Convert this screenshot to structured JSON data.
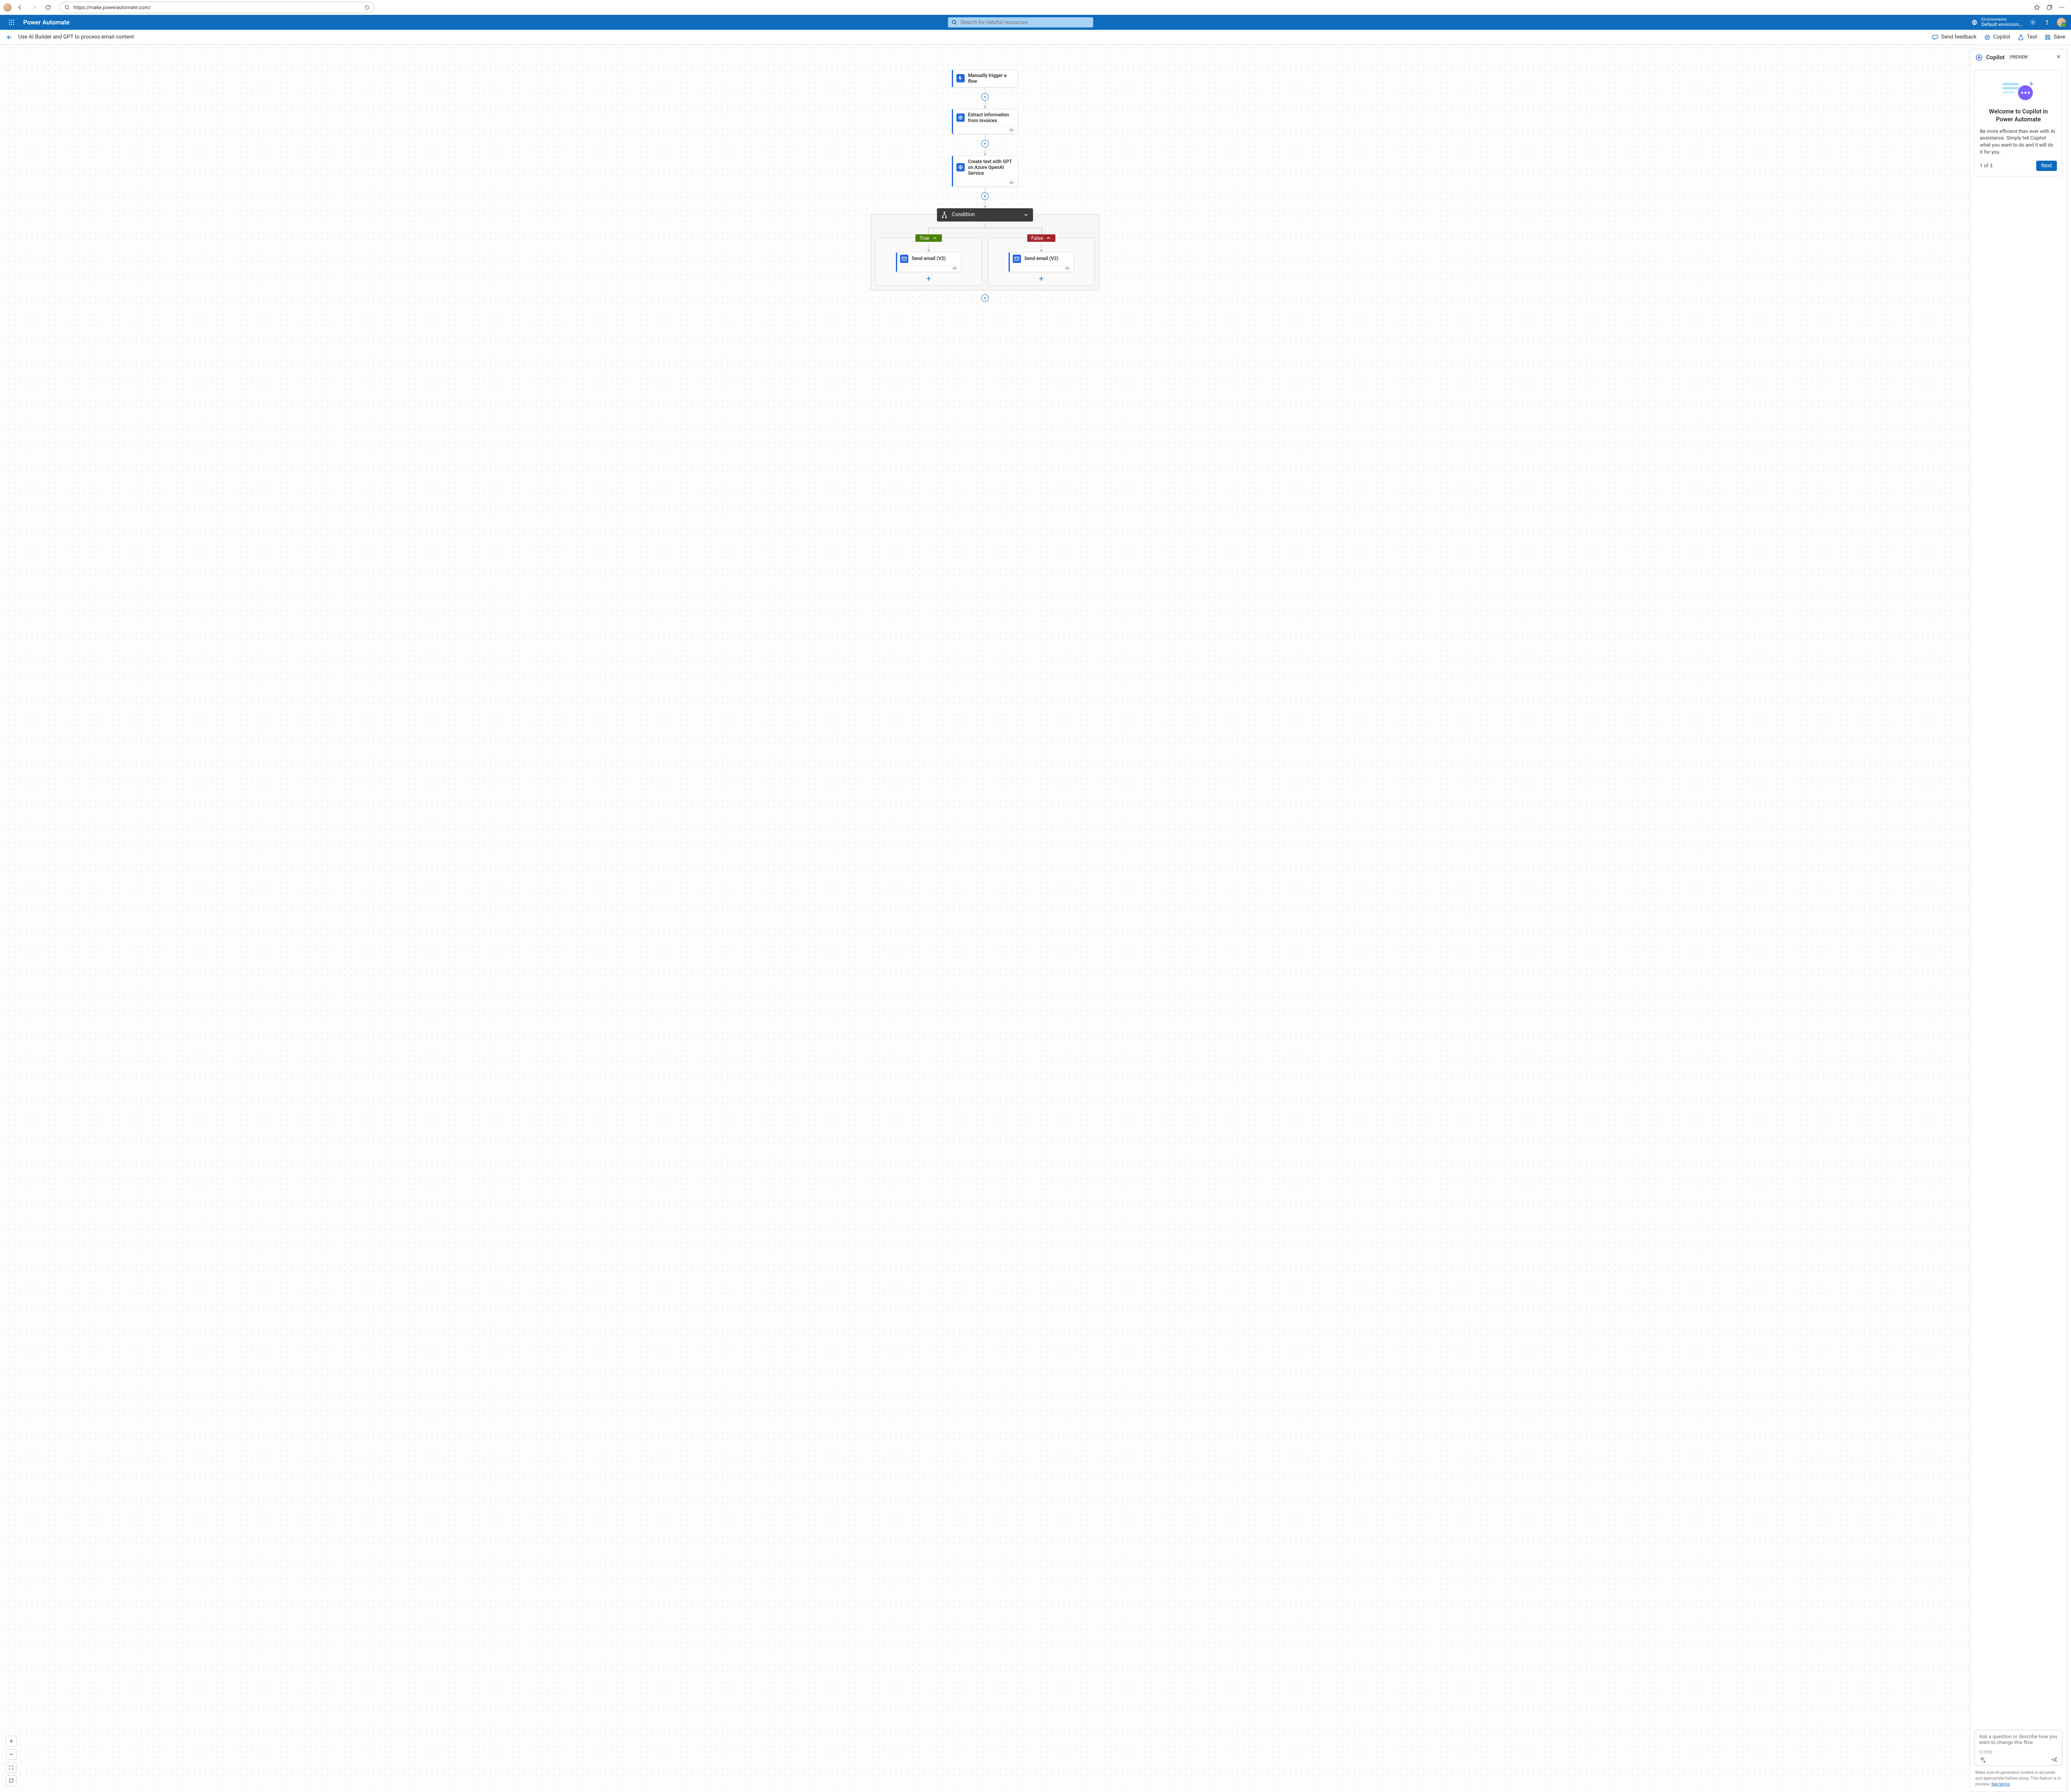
{
  "browser": {
    "url": "https://make.powerautomate.com/"
  },
  "header": {
    "app_name": "Power Automate",
    "search_placeholder": "Search for helpful resources",
    "env_label": "Environments",
    "env_value": "Default environm..."
  },
  "toolbar": {
    "flow_title": "Use AI Builder and GPT to process email content",
    "feedback": "Send feedback",
    "copilot": "Copilot",
    "test": "Test",
    "save": "Save"
  },
  "flow": {
    "node1": "Manually trigger a flow",
    "node2": "Extract information from invoices",
    "node3": "Create text with GPT on Azure OpenAI Service",
    "condition": "Condition",
    "true_label": "True",
    "false_label": "False",
    "action_true": "Send email (V2)",
    "action_false": "Send email (V2)"
  },
  "copilot": {
    "title": "Copilot",
    "badge": "PREVIEW",
    "welcome_title": "Welcome to Copilot in Power Automate",
    "welcome_body": "Be more efficient than ever with AI assistance. Simply tell Copilot what you want to do and it will do it for you.",
    "progress": "1 of 3",
    "next": "Next",
    "placeholder": "Ask a question or describe how you want to change this flow",
    "counter": "0/2000",
    "disclaimer_pre": "Make sure AI-generated content is accurate and appropriate before using. This feature is in preview. ",
    "disclaimer_link": "See terms"
  }
}
